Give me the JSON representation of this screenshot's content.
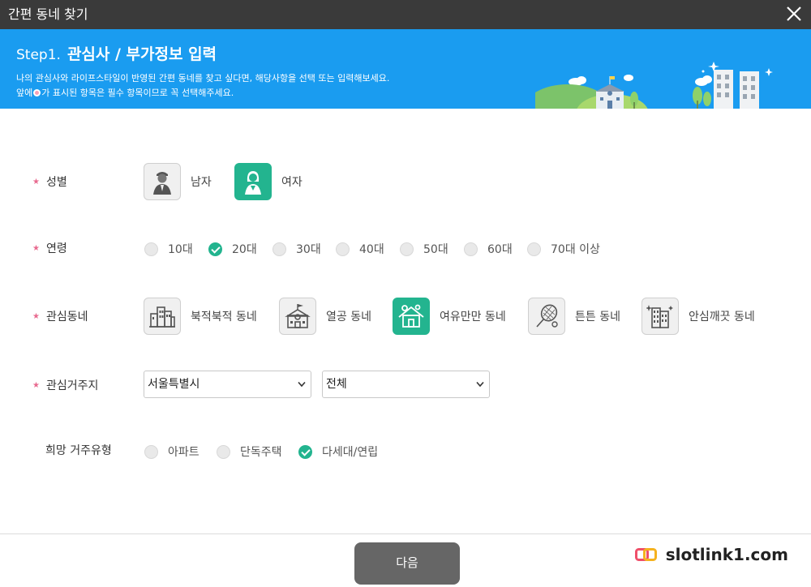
{
  "window": {
    "title": "간편 동네 찾기"
  },
  "banner": {
    "step_num": "Step1.",
    "step_title": "관심사 / 부가정보 입력",
    "desc_line1": "나의 관심사와 라이프스타일이 반영된 간편 동네를 찾고 싶다면, 해당사항을 선택 또는 입력해보세요.",
    "desc_line2_pre": "앞에",
    "desc_line2_post": "가 표시된 항목은 필수 항목이므로 꼭 선택해주세요."
  },
  "required_mark": "★",
  "gender": {
    "label": "성별",
    "options": [
      {
        "label": "남자",
        "icon": "man-icon",
        "selected": false
      },
      {
        "label": "여자",
        "icon": "woman-icon",
        "selected": true
      }
    ]
  },
  "age": {
    "label": "연령",
    "options": [
      {
        "label": "10대",
        "selected": false
      },
      {
        "label": "20대",
        "selected": true
      },
      {
        "label": "30대",
        "selected": false
      },
      {
        "label": "40대",
        "selected": false
      },
      {
        "label": "50대",
        "selected": false
      },
      {
        "label": "60대",
        "selected": false
      },
      {
        "label": "70대 이상",
        "selected": false
      }
    ]
  },
  "interest": {
    "label": "관심동네",
    "options": [
      {
        "label": "북적북적 동네",
        "icon": "buildings-icon",
        "selected": false
      },
      {
        "label": "열공 동네",
        "icon": "school-icon",
        "selected": false
      },
      {
        "label": "여유만만 동네",
        "icon": "house-icon",
        "selected": true
      },
      {
        "label": "튼튼 동네",
        "icon": "tennis-racket-icon",
        "selected": false
      },
      {
        "label": "안심깨끗 동네",
        "icon": "clean-building-icon",
        "selected": false
      }
    ]
  },
  "location": {
    "label": "관심거주지",
    "city": "서울특별시",
    "district": "전체"
  },
  "housing": {
    "label": "희망 거주유형",
    "options": [
      {
        "label": "아파트",
        "selected": false
      },
      {
        "label": "단독주택",
        "selected": false
      },
      {
        "label": "다세대/연립",
        "selected": true
      }
    ]
  },
  "footer": {
    "next_label": "다음"
  },
  "watermark": {
    "text": "slotlink1.com"
  },
  "colors": {
    "accent": "#23b48f",
    "banner": "#1a9cf0",
    "titlebar": "#3a3a3a",
    "star": "#e86a8f"
  }
}
